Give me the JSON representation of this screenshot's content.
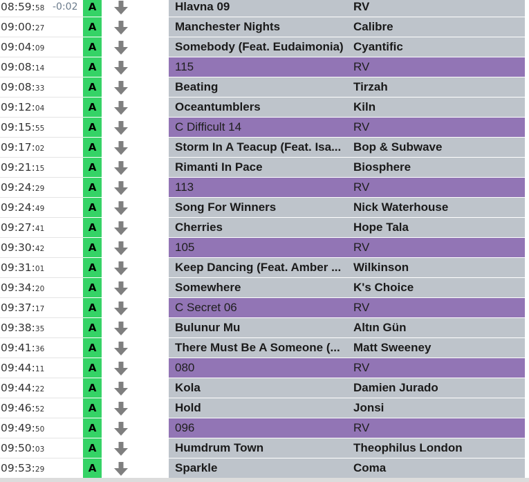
{
  "first_offset": "-0:02",
  "colors": {
    "badge": "#35d366",
    "song_row": "#bec4cb",
    "marker_row": "#9275b5"
  },
  "icons": {
    "row_action": "down-arrow-icon"
  },
  "rows": [
    {
      "time_main": "08:59:",
      "time_sec": "58",
      "badge": "A",
      "title": "Hlavna 09",
      "artist": "RV",
      "kind": "song"
    },
    {
      "time_main": "09:00:",
      "time_sec": "27",
      "badge": "A",
      "title": "Manchester Nights",
      "artist": "Calibre",
      "kind": "song"
    },
    {
      "time_main": "09:04:",
      "time_sec": "09",
      "badge": "A",
      "title": "Somebody (Feat. Eudaimonia)",
      "artist": "Cyantific",
      "kind": "song"
    },
    {
      "time_main": "09:08:",
      "time_sec": "14",
      "badge": "A",
      "title": "115",
      "artist": "RV",
      "kind": "marker"
    },
    {
      "time_main": "09:08:",
      "time_sec": "33",
      "badge": "A",
      "title": "Beating",
      "artist": "Tirzah",
      "kind": "song"
    },
    {
      "time_main": "09:12:",
      "time_sec": "04",
      "badge": "A",
      "title": "Oceantumblers",
      "artist": "Kiln",
      "kind": "song"
    },
    {
      "time_main": "09:15:",
      "time_sec": "55",
      "badge": "A",
      "title": "C Difficult 14",
      "artist": "RV",
      "kind": "marker"
    },
    {
      "time_main": "09:17:",
      "time_sec": "02",
      "badge": "A",
      "title": "Storm In A Teacup (Feat. Isa...",
      "artist": "Bop & Subwave",
      "kind": "song"
    },
    {
      "time_main": "09:21:",
      "time_sec": "15",
      "badge": "A",
      "title": "Rimanti In Pace",
      "artist": "Biosphere",
      "kind": "song"
    },
    {
      "time_main": "09:24:",
      "time_sec": "29",
      "badge": "A",
      "title": "113",
      "artist": "RV",
      "kind": "marker"
    },
    {
      "time_main": "09:24:",
      "time_sec": "49",
      "badge": "A",
      "title": "Song For Winners",
      "artist": "Nick Waterhouse",
      "kind": "song"
    },
    {
      "time_main": "09:27:",
      "time_sec": "41",
      "badge": "A",
      "title": "Cherries",
      "artist": "Hope Tala",
      "kind": "song"
    },
    {
      "time_main": "09:30:",
      "time_sec": "42",
      "badge": "A",
      "title": "105",
      "artist": "RV",
      "kind": "marker"
    },
    {
      "time_main": "09:31:",
      "time_sec": "01",
      "badge": "A",
      "title": "Keep Dancing (Feat. Amber ...",
      "artist": "Wilkinson",
      "kind": "song"
    },
    {
      "time_main": "09:34:",
      "time_sec": "20",
      "badge": "A",
      "title": "Somewhere",
      "artist": "K's Choice",
      "kind": "song"
    },
    {
      "time_main": "09:37:",
      "time_sec": "17",
      "badge": "A",
      "title": "C Secret 06",
      "artist": "RV",
      "kind": "marker"
    },
    {
      "time_main": "09:38:",
      "time_sec": "35",
      "badge": "A",
      "title": "Bulunur Mu",
      "artist": "Altın Gün",
      "kind": "song"
    },
    {
      "time_main": "09:41:",
      "time_sec": "36",
      "badge": "A",
      "title": "There Must Be A Someone (...",
      "artist": "Matt Sweeney",
      "kind": "song"
    },
    {
      "time_main": "09:44:",
      "time_sec": "11",
      "badge": "A",
      "title": "080",
      "artist": "RV",
      "kind": "marker"
    },
    {
      "time_main": "09:44:",
      "time_sec": "22",
      "badge": "A",
      "title": "Kola",
      "artist": "Damien Jurado",
      "kind": "song"
    },
    {
      "time_main": "09:46:",
      "time_sec": "52",
      "badge": "A",
      "title": "Hold",
      "artist": "Jonsi",
      "kind": "song"
    },
    {
      "time_main": "09:49:",
      "time_sec": "50",
      "badge": "A",
      "title": "096",
      "artist": "RV",
      "kind": "marker"
    },
    {
      "time_main": "09:50:",
      "time_sec": "03",
      "badge": "A",
      "title": "Humdrum Town",
      "artist": "Theophilus London",
      "kind": "song"
    },
    {
      "time_main": "09:53:",
      "time_sec": "29",
      "badge": "A",
      "title": "Sparkle",
      "artist": "Coma",
      "kind": "song"
    }
  ]
}
